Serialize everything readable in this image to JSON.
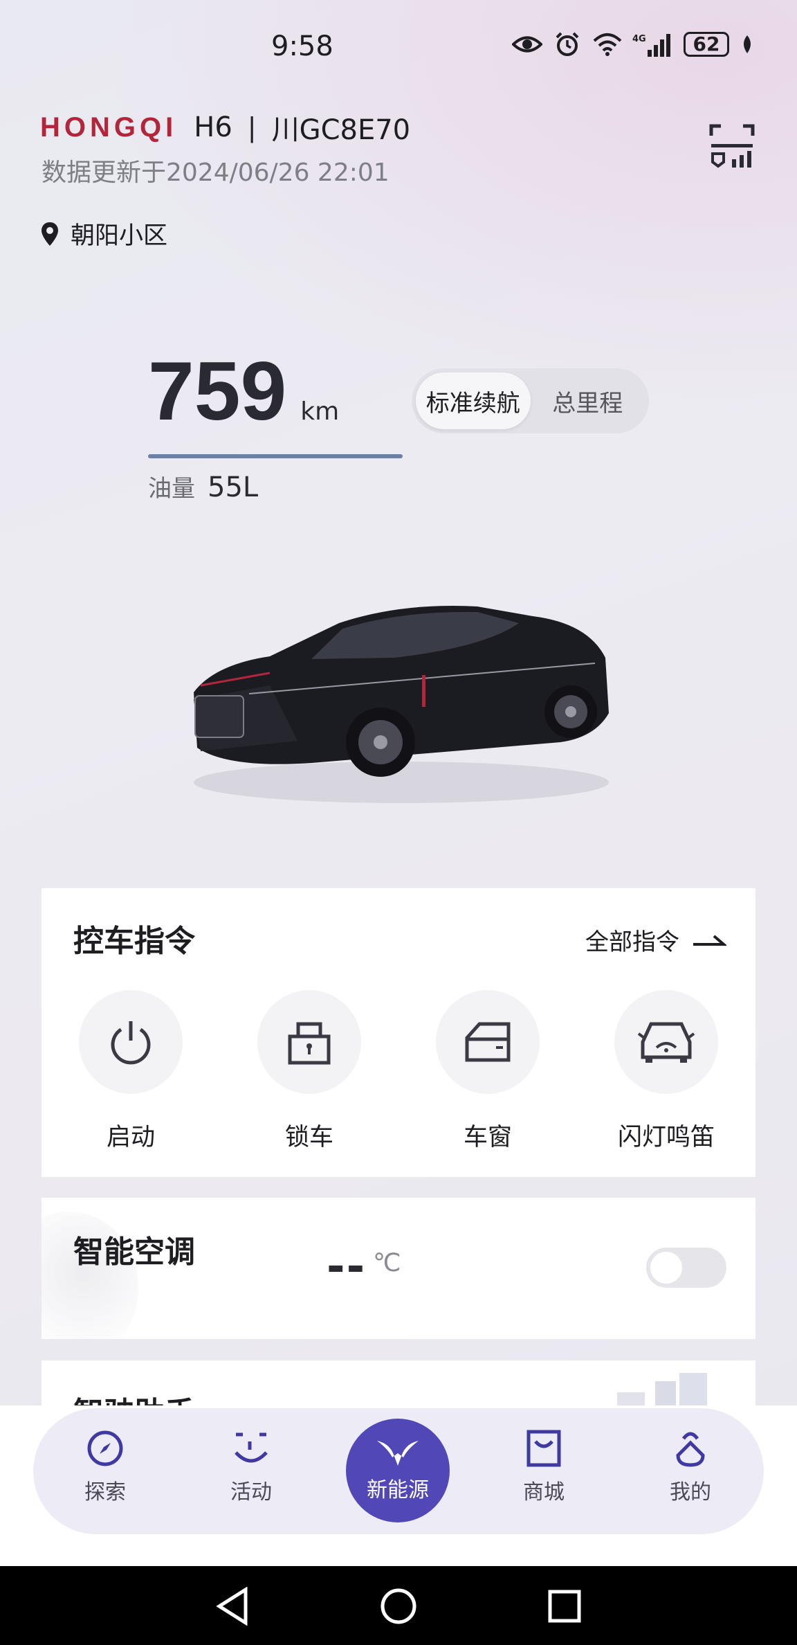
{
  "status_bar": {
    "time": "9:58",
    "network": "4G",
    "battery": "62"
  },
  "header": {
    "brand": "HONGQI",
    "model": "H6",
    "separator": "|",
    "plate": "川GC8E70",
    "updated": "数据更新于2024/06/26 22:01",
    "location": "朝阳小区"
  },
  "range": {
    "value": "759",
    "unit": "km",
    "bar_fill_percent": 100,
    "fuel_label": "油量",
    "fuel_value": "55L",
    "modes": [
      "标准续航",
      "总里程"
    ],
    "active_mode": "标准续航"
  },
  "control": {
    "title": "控车指令",
    "all_label": "全部指令",
    "commands": [
      {
        "label": "启动",
        "icon": "power-icon"
      },
      {
        "label": "锁车",
        "icon": "lock-icon"
      },
      {
        "label": "车窗",
        "icon": "window-icon"
      },
      {
        "label": "闪灯鸣笛",
        "icon": "car-horn-icon"
      }
    ]
  },
  "ac": {
    "title": "智能空调",
    "temp": "--",
    "unit": "℃",
    "enabled": false
  },
  "assistant": {
    "title": "智驶助手"
  },
  "bottom_nav": {
    "items": [
      {
        "label": "探索",
        "icon": "compass-icon"
      },
      {
        "label": "活动",
        "icon": "smile-icon"
      },
      {
        "label": "新能源",
        "icon": "hongqi-logo-icon",
        "active": true
      },
      {
        "label": "商城",
        "icon": "shopping-bag-icon"
      },
      {
        "label": "我的",
        "icon": "profile-icon"
      }
    ]
  },
  "colors": {
    "brand_red": "#b3253a",
    "accent_purple": "#5147b6",
    "range_bar": "#6b82a6"
  }
}
